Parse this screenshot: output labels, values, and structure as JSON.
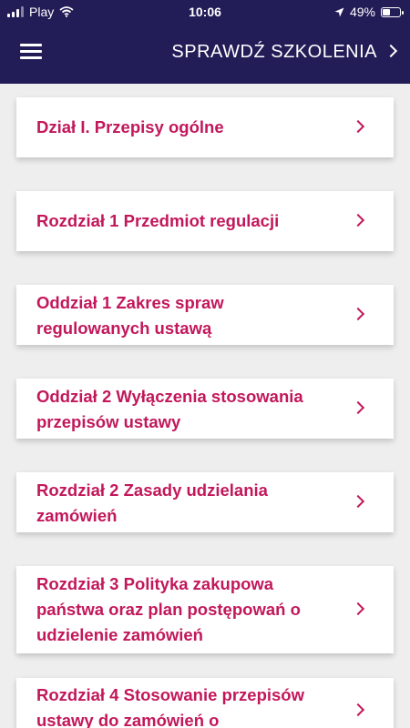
{
  "status_bar": {
    "carrier": "Play",
    "time": "10:06",
    "battery_text": "49%",
    "battery_level": 0.49
  },
  "header": {
    "title": "SPRAWDŹ SZKOLENIA",
    "background_color": "#221c57"
  },
  "accent_color": "#c2185b",
  "items": [
    {
      "label": "Dział I. Przepisy ogólne"
    },
    {
      "label": "Rozdział 1 Przedmiot regulacji"
    },
    {
      "label": "Oddział 1 Zakres spraw regulowanych ustawą"
    },
    {
      "label": "Oddział 2 Wyłączenia stosowania przepisów ustawy"
    },
    {
      "label": "Rozdział 2 Zasady udzielania zamówień"
    },
    {
      "label": "Rozdział 3 Polityka zakupowa państwa oraz plan postępowań o udzielenie zamówień"
    },
    {
      "label": "Rozdział 4 Stosowanie przepisów ustawy do zamówień o"
    }
  ]
}
